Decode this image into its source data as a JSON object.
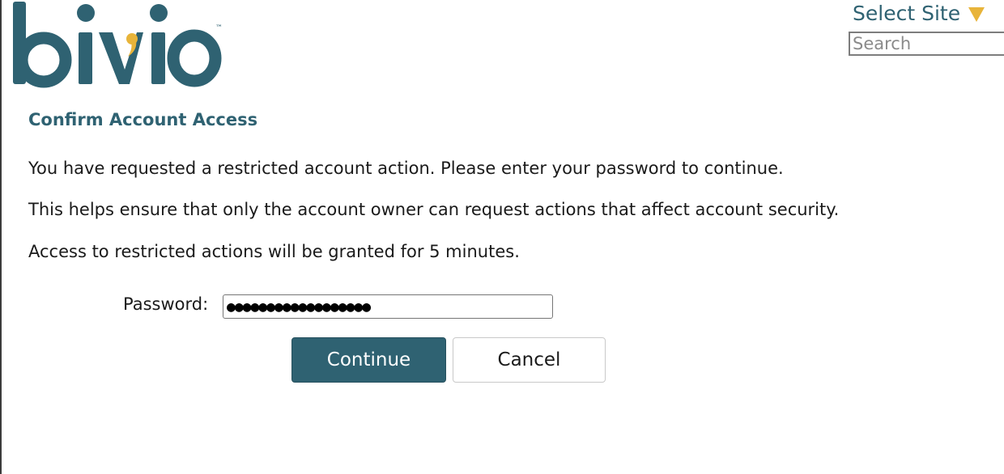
{
  "brand": {
    "logo_text": "bivio",
    "trademark": "™",
    "primary_color": "#2f6272",
    "accent_color": "#e8b43a"
  },
  "header": {
    "select_site_label": "Select Site",
    "select_site_icon": "caret-down-icon",
    "search_placeholder": "Search",
    "search_value": ""
  },
  "main": {
    "title": "Confirm Account Access",
    "paragraphs": [
      "You have requested a restricted account action. Please enter your password to continue.",
      "This helps ensure that only the account owner can request actions that affect account security.",
      "Access to restricted actions will be granted for 5 minutes."
    ],
    "password_label": "Password:",
    "password_value": "●●●●●●●●●●●●●●●●●●",
    "continue_label": "Continue",
    "cancel_label": "Cancel"
  }
}
